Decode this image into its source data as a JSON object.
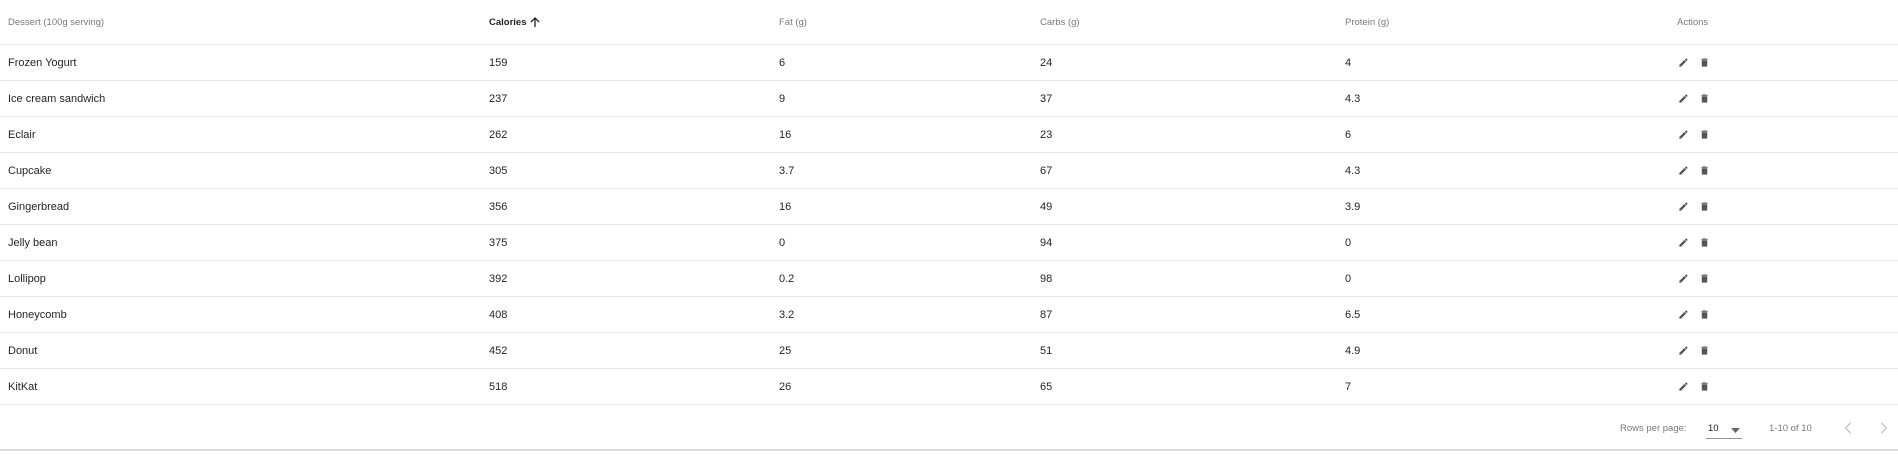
{
  "table": {
    "headers": {
      "dessert": "Dessert (100g serving)",
      "calories": "Calories",
      "fat": "Fat (g)",
      "carbs": "Carbs (g)",
      "protein": "Protein (g)",
      "actions": "Actions"
    },
    "sort": {
      "column": "calories",
      "direction": "ascending",
      "icon": "arrow-up-icon"
    },
    "rows": [
      {
        "name": "Frozen Yogurt",
        "calories": "159",
        "fat": "6",
        "carbs": "24",
        "protein": "4"
      },
      {
        "name": "Ice cream sandwich",
        "calories": "237",
        "fat": "9",
        "carbs": "37",
        "protein": "4.3"
      },
      {
        "name": "Eclair",
        "calories": "262",
        "fat": "16",
        "carbs": "23",
        "protein": "6"
      },
      {
        "name": "Cupcake",
        "calories": "305",
        "fat": "3.7",
        "carbs": "67",
        "protein": "4.3"
      },
      {
        "name": "Gingerbread",
        "calories": "356",
        "fat": "16",
        "carbs": "49",
        "protein": "3.9"
      },
      {
        "name": "Jelly bean",
        "calories": "375",
        "fat": "0",
        "carbs": "94",
        "protein": "0"
      },
      {
        "name": "Lollipop",
        "calories": "392",
        "fat": "0.2",
        "carbs": "98",
        "protein": "0"
      },
      {
        "name": "Honeycomb",
        "calories": "408",
        "fat": "3.2",
        "carbs": "87",
        "protein": "6.5"
      },
      {
        "name": "Donut",
        "calories": "452",
        "fat": "25",
        "carbs": "51",
        "protein": "4.9"
      },
      {
        "name": "KitKat",
        "calories": "518",
        "fat": "26",
        "carbs": "65",
        "protein": "7"
      }
    ],
    "row_actions": {
      "edit_icon": "pencil-icon",
      "delete_icon": "trash-icon"
    }
  },
  "pagination": {
    "rows_per_page_label": "Rows per page:",
    "rows_per_page_value": "10",
    "range_label": "1-10 of 10",
    "prev_icon": "chevron-left-icon",
    "next_icon": "chevron-right-icon",
    "prev_disabled": true,
    "next_disabled": true
  },
  "colors": {
    "text_primary": "#212121",
    "text_secondary": "#757575",
    "divider": "#e6e6e6",
    "icon": "#555555"
  }
}
